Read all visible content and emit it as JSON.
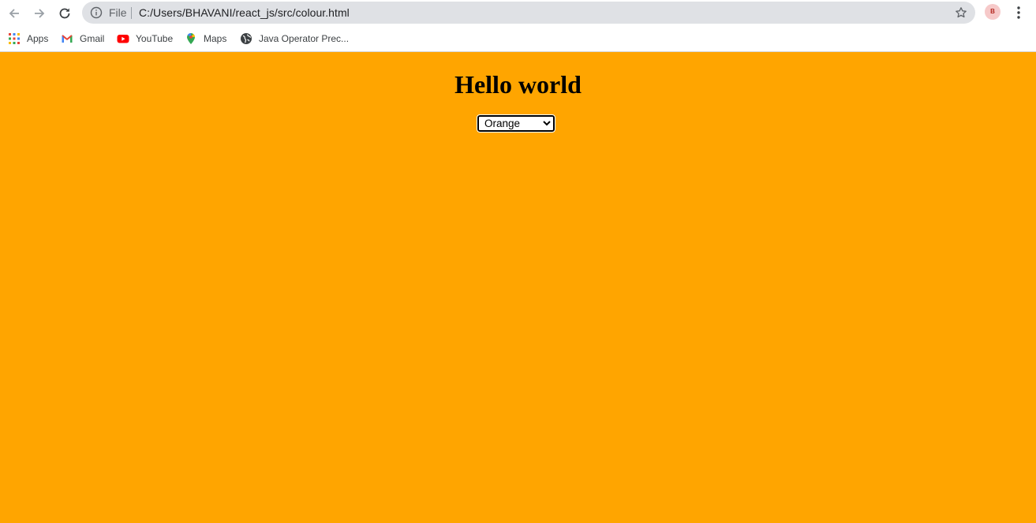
{
  "browser": {
    "address_scheme": "File",
    "address_url": "C:/Users/BHAVANI/react_js/src/colour.html",
    "profile_initial": "B",
    "icons": [
      "back-arrow-icon",
      "forward-arrow-icon",
      "reload-icon",
      "info-icon",
      "star-icon",
      "kebab-menu-icon"
    ]
  },
  "bookmarks": [
    {
      "label": "Apps",
      "icon": "apps-grid-icon"
    },
    {
      "label": "Gmail",
      "icon": "gmail-icon"
    },
    {
      "label": "YouTube",
      "icon": "youtube-icon"
    },
    {
      "label": "Maps",
      "icon": "maps-pin-icon"
    },
    {
      "label": "Java Operator Prec...",
      "icon": "globe-icon"
    }
  ],
  "page": {
    "background_color": "#ffa500",
    "heading": "Hello world",
    "select": {
      "selected": "Orange",
      "options": [
        "Orange"
      ]
    }
  }
}
